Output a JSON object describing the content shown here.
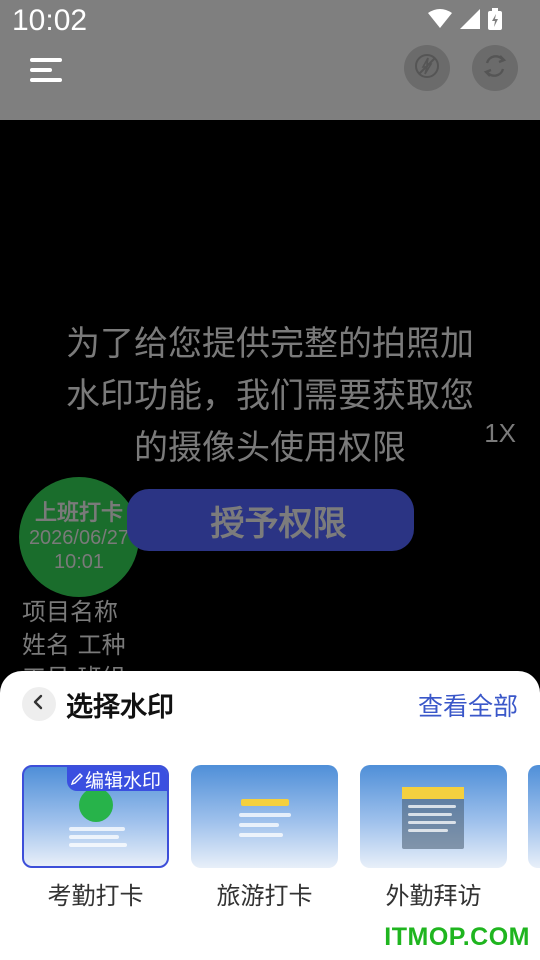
{
  "status_bar": {
    "time": "10:02"
  },
  "camera": {
    "permission_message": "为了给您提供完整的拍照加水印功能，我们需要获取您的摄像头使用权限",
    "zoom": "1X",
    "grant_button": "授予权限"
  },
  "watermark_preview": {
    "title": "上班打卡",
    "date": "2026/06/27",
    "time": "10:01",
    "line1": "项目名称",
    "line2": "姓名 工种",
    "line3": "工号 班组"
  },
  "sheet": {
    "title": "选择水印",
    "view_all": "查看全部",
    "edit_badge": "编辑水印",
    "cards": [
      {
        "label": "考勤打卡"
      },
      {
        "label": "旅游打卡"
      },
      {
        "label": "外勤拜访"
      }
    ]
  },
  "brand": "ITMOP.COM"
}
